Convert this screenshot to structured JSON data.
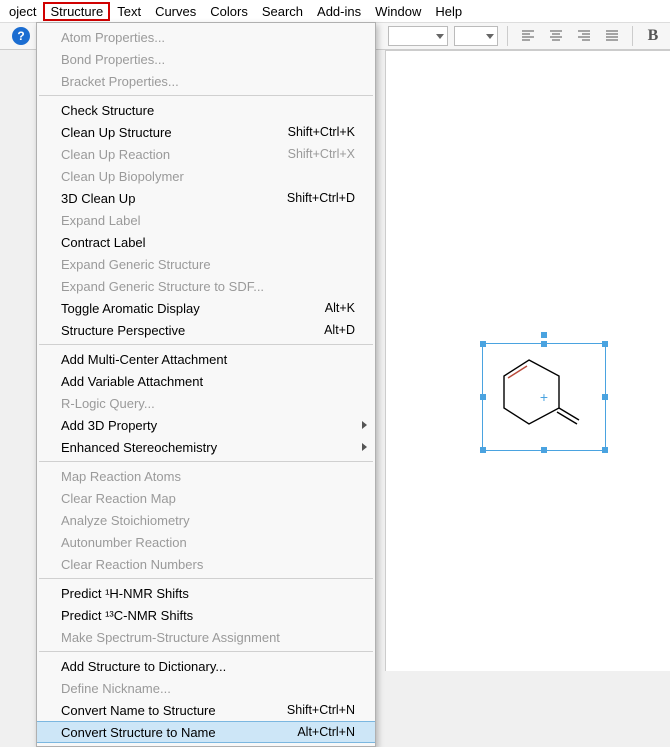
{
  "menubar": {
    "items": [
      "oject",
      "Structure",
      "Text",
      "Curves",
      "Colors",
      "Search",
      "Add-ins",
      "Window",
      "Help"
    ],
    "highlighted_index": 1
  },
  "toolbar": {
    "help_glyph": "?",
    "bold_glyph": "B"
  },
  "menu": {
    "groups": [
      [
        {
          "label": "Atom Properties...",
          "disabled": true
        },
        {
          "label": "Bond Properties...",
          "disabled": true
        },
        {
          "label": "Bracket Properties...",
          "disabled": true
        }
      ],
      [
        {
          "label": "Check Structure"
        },
        {
          "label": "Clean Up Structure",
          "shortcut": "Shift+Ctrl+K"
        },
        {
          "label": "Clean Up Reaction",
          "shortcut": "Shift+Ctrl+X",
          "disabled": true
        },
        {
          "label": "Clean Up Biopolymer",
          "disabled": true
        },
        {
          "label": "3D Clean Up",
          "shortcut": "Shift+Ctrl+D"
        },
        {
          "label": "Expand Label",
          "disabled": true
        },
        {
          "label": "Contract Label"
        },
        {
          "label": "Expand Generic Structure",
          "disabled": true
        },
        {
          "label": "Expand Generic Structure to SDF...",
          "disabled": true
        },
        {
          "label": "Toggle Aromatic Display",
          "shortcut": "Alt+K"
        },
        {
          "label": "Structure Perspective",
          "shortcut": "Alt+D"
        }
      ],
      [
        {
          "label": "Add Multi-Center Attachment"
        },
        {
          "label": "Add Variable Attachment"
        },
        {
          "label": "R-Logic Query...",
          "disabled": true
        },
        {
          "label": "Add 3D Property",
          "submenu": true
        },
        {
          "label": "Enhanced Stereochemistry",
          "submenu": true
        }
      ],
      [
        {
          "label": "Map Reaction Atoms",
          "disabled": true
        },
        {
          "label": "Clear Reaction Map",
          "disabled": true
        },
        {
          "label": "Analyze Stoichiometry",
          "disabled": true
        },
        {
          "label": "Autonumber Reaction",
          "disabled": true
        },
        {
          "label": "Clear Reaction Numbers",
          "disabled": true
        }
      ],
      [
        {
          "label": "Predict ¹H-NMR Shifts"
        },
        {
          "label": "Predict ¹³C-NMR Shifts"
        },
        {
          "label": "Make Spectrum-Structure Assignment",
          "disabled": true
        }
      ],
      [
        {
          "label": "Add Structure to Dictionary..."
        },
        {
          "label": "Define Nickname...",
          "disabled": true
        },
        {
          "label": "Convert Name to Structure",
          "shortcut": "Shift+Ctrl+N"
        },
        {
          "label": "Convert Structure to Name",
          "shortcut": "Alt+Ctrl+N",
          "highlighted": true
        }
      ]
    ]
  }
}
